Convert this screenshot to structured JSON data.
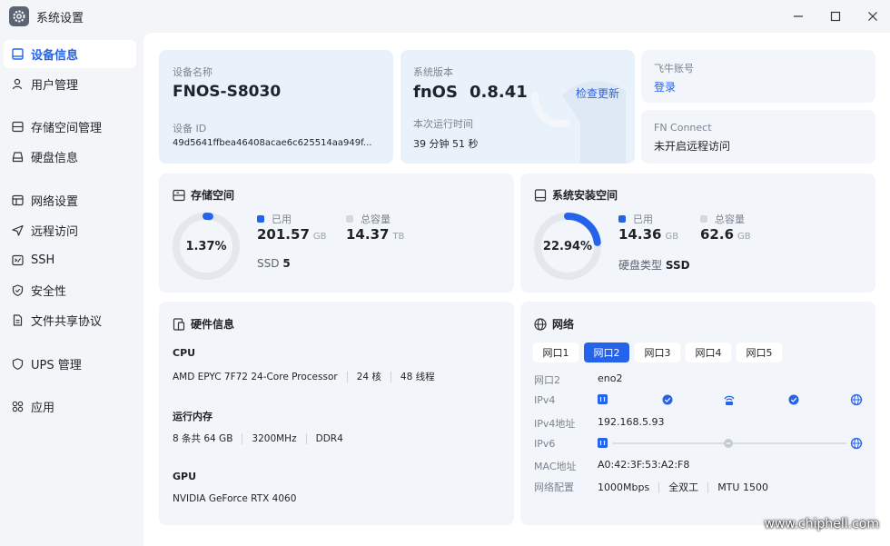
{
  "window": {
    "title": "系统设置"
  },
  "sidebar": {
    "items": [
      {
        "label": "设备信息",
        "icon": "monitor-icon",
        "active": true
      },
      {
        "label": "用户管理",
        "icon": "user-icon"
      },
      {
        "label": "存储空间管理",
        "icon": "storage-icon"
      },
      {
        "label": "硬盘信息",
        "icon": "harddisk-icon"
      },
      {
        "label": "网络设置",
        "icon": "network-settings-icon"
      },
      {
        "label": "远程访问",
        "icon": "send-icon"
      },
      {
        "label": "SSH",
        "icon": "terminal-icon"
      },
      {
        "label": "安全性",
        "icon": "shield-icon"
      },
      {
        "label": "文件共享协议",
        "icon": "document-icon"
      },
      {
        "label": "UPS 管理",
        "icon": "ups-shield-icon"
      },
      {
        "label": "应用",
        "icon": "apps-grid-icon"
      }
    ]
  },
  "device": {
    "name_label": "设备名称",
    "name": "FNOS-S8030",
    "id_label": "设备 ID",
    "id": "49d5641ffbea46408acae6c625514aa949f..."
  },
  "system": {
    "version_label": "系统版本",
    "os_name": "fnOS",
    "version": "0.8.41",
    "check_update": "检查更新",
    "uptime_label": "本次运行时间",
    "uptime": "39 分钟 51 秒"
  },
  "account": {
    "label": "飞牛账号",
    "login": "登录"
  },
  "fnconnect": {
    "label": "FN Connect",
    "status": "未开启远程访问"
  },
  "storage": {
    "title": "存储空间",
    "percent_text": "1.37%",
    "percent": 1.37,
    "used_label": "已用",
    "used": "201.57",
    "used_unit": "GB",
    "total_label": "总容量",
    "total": "14.37",
    "total_unit": "TB",
    "disk_type": "SSD",
    "disk_count": "5"
  },
  "sysvol": {
    "title": "系统安装空间",
    "percent_text": "22.94%",
    "percent": 22.94,
    "used_label": "已用",
    "used": "14.36",
    "used_unit": "GB",
    "total_label": "总容量",
    "total": "62.6",
    "total_unit": "GB",
    "disk_type_label": "硬盘类型",
    "disk_type": "SSD"
  },
  "hardware": {
    "title": "硬件信息",
    "cpu_label": "CPU",
    "cpu_model": "AMD EPYC 7F72 24-Core Processor",
    "cpu_cores": "24 核",
    "cpu_threads": "48 线程",
    "mem_label": "运行内存",
    "mem_modules": "8 条共 64 GB",
    "mem_speed": "3200MHz",
    "mem_type": "DDR4",
    "gpu_label": "GPU",
    "gpu_model": "NVIDIA GeForce RTX 4060"
  },
  "network": {
    "title": "网络",
    "tabs": [
      "网口1",
      "网口2",
      "网口3",
      "网口4",
      "网口5"
    ],
    "active_tab": 1,
    "port_label": "网口2",
    "port_value": "eno2",
    "ipv4_label": "IPv4",
    "ipv4_addr_label": "IPv4地址",
    "ipv4_addr": "192.168.5.93",
    "ipv6_label": "IPv6",
    "mac_label": "MAC地址",
    "mac": "A0:42:3F:53:A2:F8",
    "config_label": "网络配置",
    "speed": "1000Mbps",
    "duplex": "全双工",
    "mtu": "MTU 1500"
  },
  "colors": {
    "accent": "#2563eb",
    "ring_track": "#e4e8ee",
    "card": "#f2f5f9",
    "card_highlight": "#e9f1fb"
  },
  "watermark": "www.chiphell.com"
}
